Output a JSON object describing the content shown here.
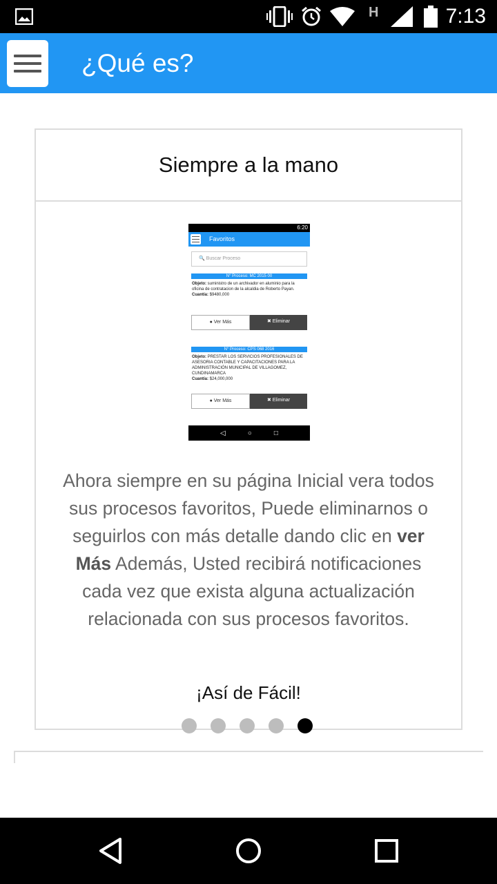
{
  "status_bar": {
    "time": "7:13",
    "icons": [
      "gallery-icon",
      "vibrate-icon",
      "alarm-icon",
      "wifi-icon",
      "h-signal-icon",
      "cell-signal-icon",
      "battery-icon"
    ],
    "h_label": "H"
  },
  "app_bar": {
    "title": "¿Qué es?",
    "color": "#2196f3"
  },
  "card": {
    "header": "Siempre a la mano",
    "description_part1": "Ahora siempre en su página Inicial vera todos sus procesos favoritos, Puede eliminarnos o seguirlos con más detalle dando clic en ",
    "description_bold": "ver Más",
    "description_part2": " Además, Usted recibirá notificaciones cada vez que exista alguna actualización relacionada con sus procesos favoritos.",
    "tagline": "¡Así de Fácil!"
  },
  "preview": {
    "status_time": "6:20",
    "title": "Favoritos",
    "search_placeholder": "Buscar Proceso",
    "items": [
      {
        "header": "N° Proceso: MC 2015 00",
        "objeto_label": "Objeto:",
        "objeto": "suministro de un archivador en aluminio para la oficina de contratacion de la alcaldia de Roberto Payan.",
        "cuantia_label": "Cuantía:",
        "cuantia": "$9480,000",
        "ver_mas": "Ver Más",
        "eliminar": "Eliminar"
      },
      {
        "header": "N° Proceso: CPS 068 2016",
        "objeto_label": "Objeto:",
        "objeto": "PRESTAR LOS SERVICIOS PROFESIONALES DE ASESORIA CONTABLE Y CAPACITACIONES PARA LA ADMINISTRACIÓN MUNICIPAL DE VILLAGOMEZ, CUNDINAMARCA",
        "cuantia_label": "Cuantía:",
        "cuantia": "$24,000,000",
        "ver_mas": "Ver Más",
        "eliminar": "Eliminar"
      }
    ]
  },
  "pager": {
    "count": 5,
    "active_index": 4
  },
  "nav_bar": {
    "buttons": [
      "back-icon",
      "home-icon",
      "recents-icon"
    ]
  }
}
